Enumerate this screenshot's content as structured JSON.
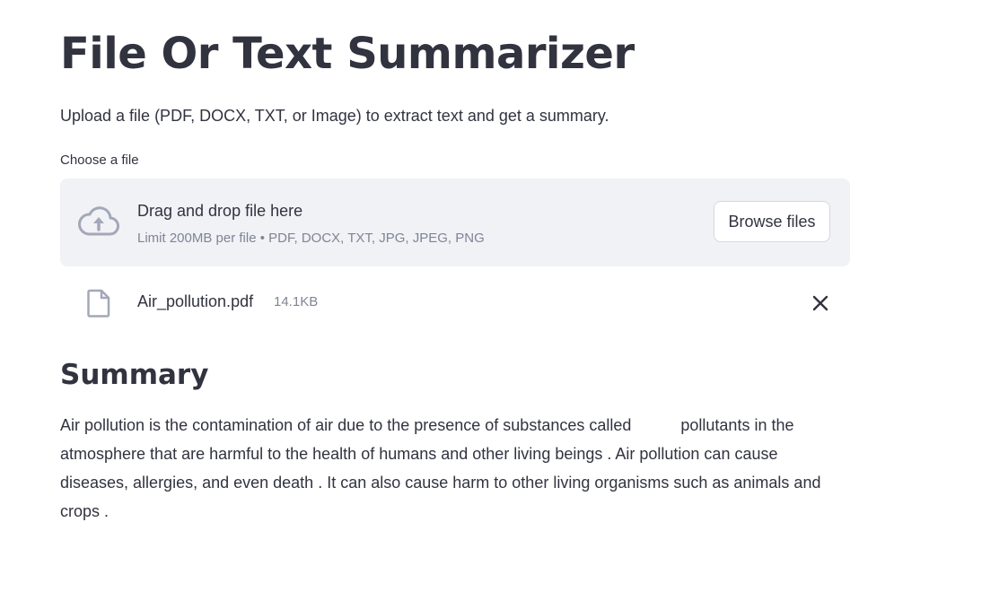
{
  "header": {
    "title": "File Or Text Summarizer",
    "subtitle": "Upload a file (PDF, DOCX, TXT, or Image) to extract text and get a summary."
  },
  "uploader": {
    "label": "Choose a file",
    "drop_title": "Drag and drop file here",
    "limit_text": "Limit 200MB per file • PDF, DOCX, TXT, JPG, JPEG, PNG",
    "browse_label": "Browse files",
    "icon": "cloud-upload-icon"
  },
  "uploaded_file": {
    "name": "Air_pollution.pdf",
    "size": "14.1KB",
    "icon": "file-icon",
    "remove_icon": "close-icon"
  },
  "summary": {
    "heading": "Summary",
    "lines": [
      "Air pollution is the contamination of air due to the presence of substances called           pollutants in the",
      "atmosphere that are harmful to the health of humans and other living beings . Air pollution can cause",
      "diseases, allergies, and even death . It can also cause harm to other living organisms such as animals and",
      "crops ."
    ]
  },
  "colors": {
    "text": "#31333f",
    "muted": "#808495",
    "dropzone_bg": "#f0f2f6",
    "icon": "#a3a8b8"
  }
}
